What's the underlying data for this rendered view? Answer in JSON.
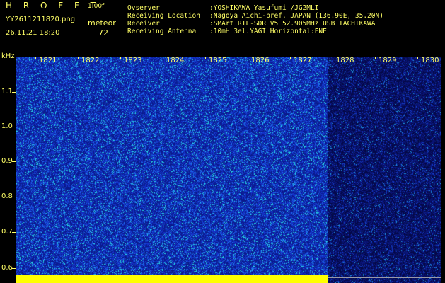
{
  "header": {
    "app_title": "H R O F F T",
    "version": "1.00f",
    "filename": "YY2611211820.png",
    "datetime": "26.11.21 18:20",
    "meteor_label": "meteor",
    "meteor_count": "72"
  },
  "station": [
    {
      "key": "Ovserver",
      "value": ":YOSHIKAWA Yasufumi /JG2MLI"
    },
    {
      "key": "Receiving Location",
      "value": ":Nagoya Aichi-pref. JAPAN (136.90E, 35.20N)"
    },
    {
      "key": "Receiver",
      "value": ":SMArt RTL-SDR V5 52.905MHz USB TACHIKAWA"
    },
    {
      "key": "Receiving Antenna",
      "value": ":10mH 3el.YAGI Horizontal:ENE"
    }
  ],
  "axis": {
    "y_unit": "kHz",
    "y_ticks": [
      "1.1",
      "1.0",
      "0.9",
      "0.8",
      "0.7",
      "0.6"
    ],
    "x_ticks": [
      "1821",
      "1822",
      "1823",
      "1824",
      "1825",
      "1826",
      "1827",
      "1828",
      "1829",
      "1830"
    ]
  },
  "colors": {
    "text": "#ffff66",
    "background": "#000000",
    "spectrogram_dense": "#1830c8",
    "spectrogram_sparse": "#0a1478",
    "signal_bar": "#ffff00"
  }
}
